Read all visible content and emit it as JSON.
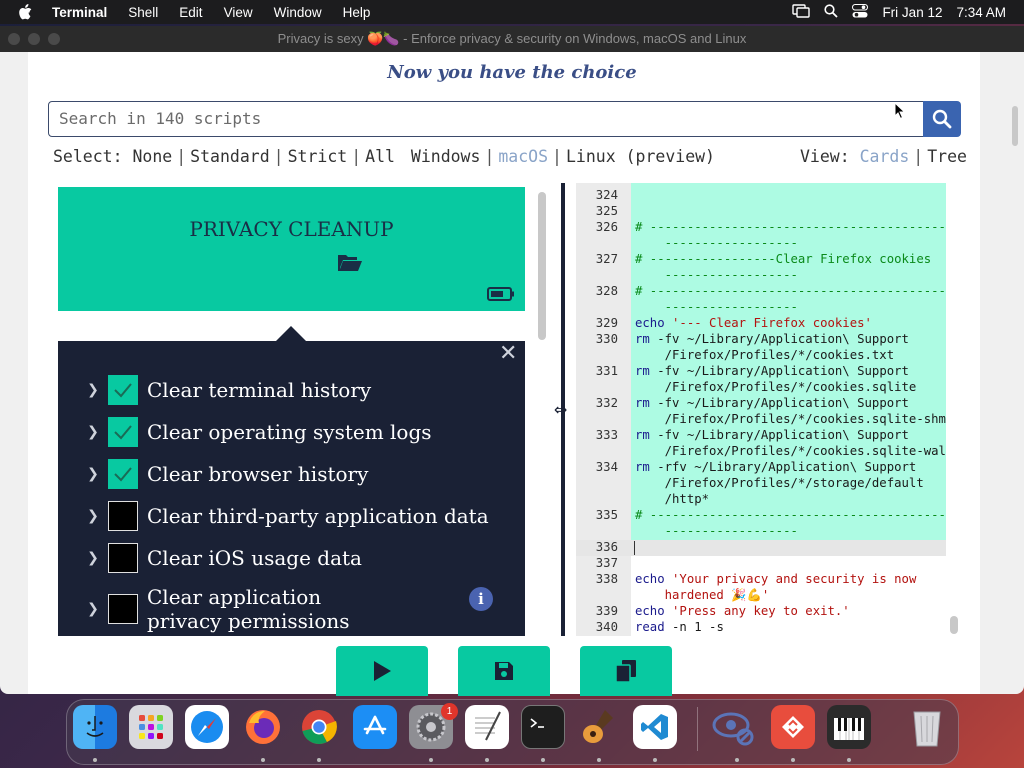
{
  "menubar": {
    "app_name": "Terminal",
    "items": [
      "Shell",
      "Edit",
      "View",
      "Window",
      "Help"
    ],
    "date": "Fri Jan 12",
    "time": "7:34 AM"
  },
  "window": {
    "title": "Privacy is sexy 🍑🍆 - Enforce privacy & security on Windows, macOS and Linux"
  },
  "tagline": "Now you have the choice",
  "search": {
    "placeholder": "Search in 140 scripts"
  },
  "select": {
    "label": "Select:",
    "options": [
      "None",
      "Standard",
      "Strict",
      "All"
    ]
  },
  "os": {
    "options": [
      "Windows",
      "macOS",
      "Linux (preview)"
    ],
    "active": "macOS"
  },
  "view": {
    "label": "View:",
    "options": [
      "Cards",
      "Tree"
    ],
    "active": "Cards"
  },
  "card": {
    "title": "PRIVACY CLEANUP"
  },
  "items": [
    {
      "label": "Clear terminal history",
      "checked": true
    },
    {
      "label": "Clear operating system logs",
      "checked": true
    },
    {
      "label": "Clear browser history",
      "checked": true
    },
    {
      "label": "Clear third-party application data",
      "checked": false
    },
    {
      "label": "Clear iOS usage data",
      "checked": false
    },
    {
      "label": "Clear application privacy permissions",
      "checked": false
    }
  ],
  "code": {
    "lines": [
      {
        "n": "324",
        "rows": [
          ""
        ],
        "hl": true
      },
      {
        "n": "325",
        "rows": [
          ""
        ],
        "hl": true
      },
      {
        "n": "326",
        "rows": [
          "# ----------------------------------------",
          "    ------------------"
        ],
        "hl": true,
        "kind": "com"
      },
      {
        "n": "327",
        "rows": [
          "# -----------------Clear Firefox cookies",
          "    ------------------"
        ],
        "hl": true,
        "kind": "com"
      },
      {
        "n": "328",
        "rows": [
          "# ----------------------------------------",
          "    ------------------"
        ],
        "hl": true,
        "kind": "com"
      },
      {
        "n": "329",
        "rows": [
          "echo '--- Clear Firefox cookies'"
        ],
        "hl": true,
        "kind": "echo"
      },
      {
        "n": "330",
        "rows": [
          "rm -fv ~/Library/Application\\ Support",
          "    /Firefox/Profiles/*/cookies.txt"
        ],
        "hl": true,
        "kind": "cmd"
      },
      {
        "n": "331",
        "rows": [
          "rm -fv ~/Library/Application\\ Support",
          "    /Firefox/Profiles/*/cookies.sqlite"
        ],
        "hl": true,
        "kind": "cmd"
      },
      {
        "n": "332",
        "rows": [
          "rm -fv ~/Library/Application\\ Support",
          "    /Firefox/Profiles/*/cookies.sqlite-shm"
        ],
        "hl": true,
        "kind": "cmd"
      },
      {
        "n": "333",
        "rows": [
          "rm -fv ~/Library/Application\\ Support",
          "    /Firefox/Profiles/*/cookies.sqlite-wal"
        ],
        "hl": true,
        "kind": "cmd"
      },
      {
        "n": "334",
        "rows": [
          "rm -rfv ~/Library/Application\\ Support",
          "    /Firefox/Profiles/*/storage/default",
          "    /http*"
        ],
        "hl": true,
        "kind": "cmd"
      },
      {
        "n": "335",
        "rows": [
          "# ----------------------------------------",
          "    ------------------"
        ],
        "hl": true,
        "kind": "com"
      },
      {
        "n": "336",
        "rows": [
          ""
        ],
        "hl": false,
        "current": true
      },
      {
        "n": "337",
        "rows": [
          ""
        ],
        "hl": false
      },
      {
        "n": "338",
        "rows": [
          "echo 'Your privacy and security is now",
          "    hardened 🎉💪'"
        ],
        "hl": false,
        "kind": "echo"
      },
      {
        "n": "339",
        "rows": [
          "echo 'Press any key to exit.'"
        ],
        "hl": false,
        "kind": "echo"
      },
      {
        "n": "340",
        "rows": [
          "read -n 1 -s"
        ],
        "hl": false,
        "kind": "read"
      }
    ]
  },
  "actions": [
    "run",
    "save",
    "copy"
  ],
  "dock": {
    "apps": [
      "Finder",
      "Launchpad",
      "Safari",
      "Firefox",
      "Chrome",
      "App Store",
      "System Settings",
      "TextEdit",
      "Terminal",
      "GarageBand",
      "Visual Studio Code",
      "Privacy Lens",
      "Git",
      "Piano",
      "Trash"
    ],
    "settings_badge": "1"
  },
  "colors": {
    "accent": "#08c9a1",
    "navy": "#1a2135",
    "link": "#3a64b0"
  }
}
